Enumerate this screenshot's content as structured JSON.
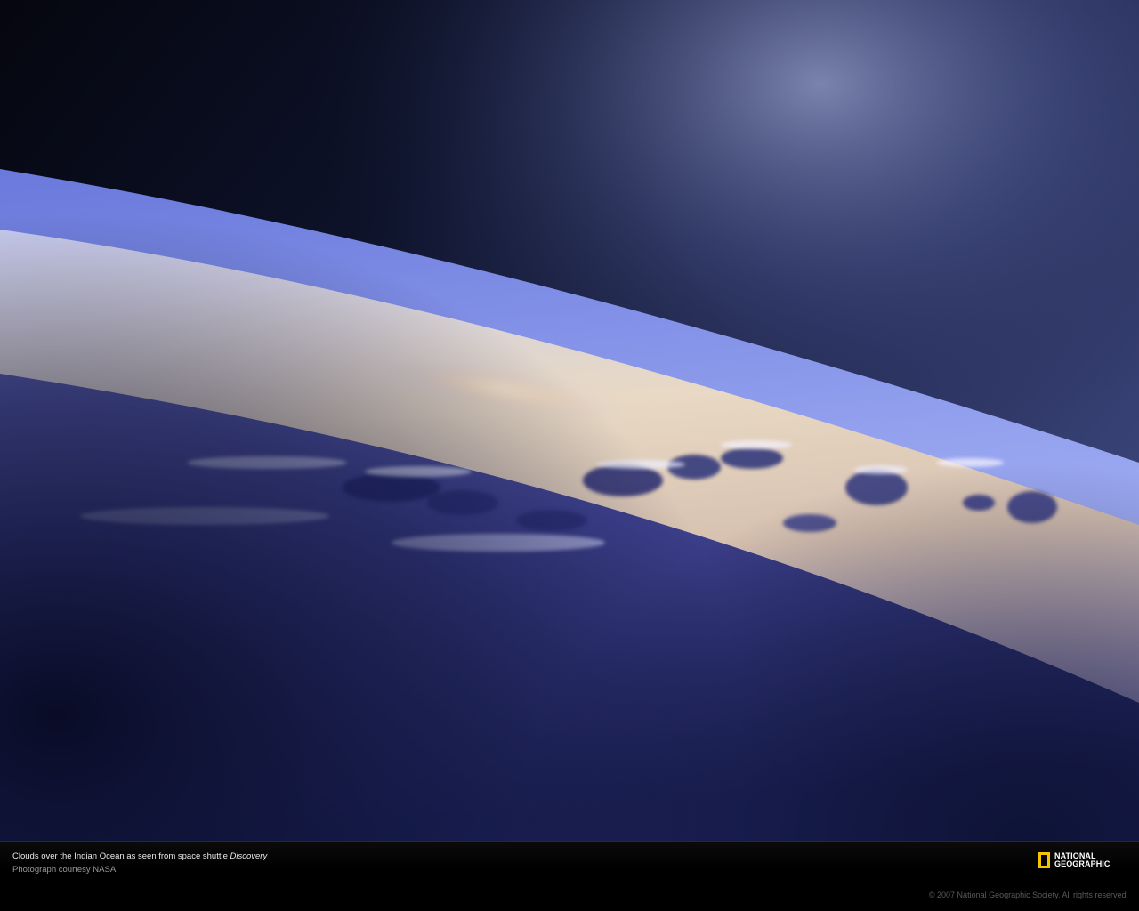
{
  "caption": {
    "title_prefix": "Clouds over the Indian Ocean as seen from space shuttle",
    "title_italic": "Discovery",
    "credit": "Photograph courtesy NASA"
  },
  "logo": {
    "line1": "NATIONAL",
    "line2": "GEOGRAPHIC",
    "frame_color": "#f5c400"
  },
  "copyright": "© 2007 National Geographic Society. All rights reserved.",
  "photo": {
    "subject": "earth-horizon-from-space",
    "colors": {
      "space": "#0c1128",
      "atmosphere": "#8f9cf2",
      "sunlit_haze": "#e9d2b0",
      "ocean": "#2a3280"
    }
  }
}
